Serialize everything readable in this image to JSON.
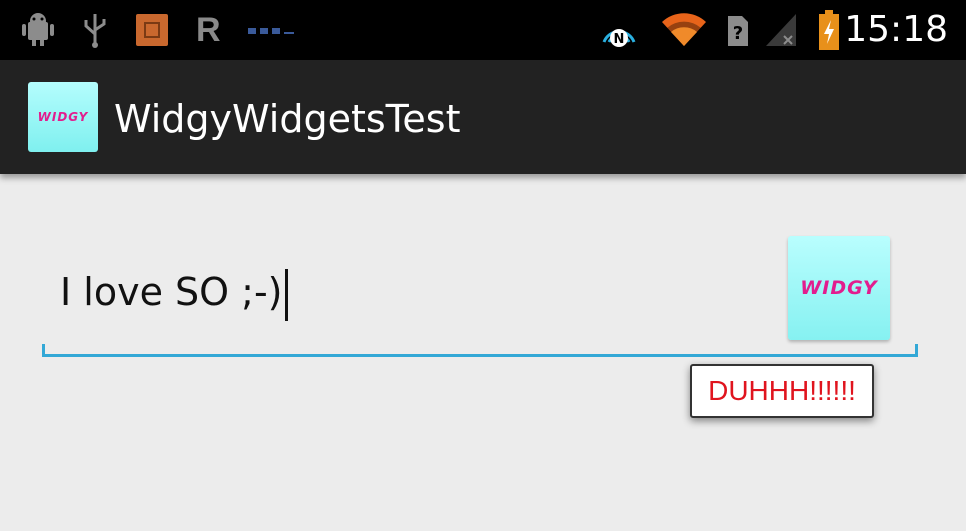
{
  "status_bar": {
    "time": "15:18",
    "icons": [
      "android-debug-icon",
      "usb-icon",
      "sd-card-icon",
      "r-icon",
      "dots-icon",
      "nfc-icon",
      "wifi-icon",
      "no-sim-icon",
      "signal-icon",
      "battery-charging-icon"
    ],
    "r_letter": "R",
    "q_letter": "?"
  },
  "action_bar": {
    "title": "WidgyWidgetsTest",
    "icon_text": "WIDGY"
  },
  "content": {
    "input_value": "I love SO ;-)",
    "widget_button_text": "WIDGY",
    "toast_text": "DUHHH!!!!!!"
  },
  "colors": {
    "accent": "#33a8d6",
    "widgy_bg": "#9df7f7",
    "widgy_text": "#e21d8e",
    "toast_text": "#e0141e"
  }
}
